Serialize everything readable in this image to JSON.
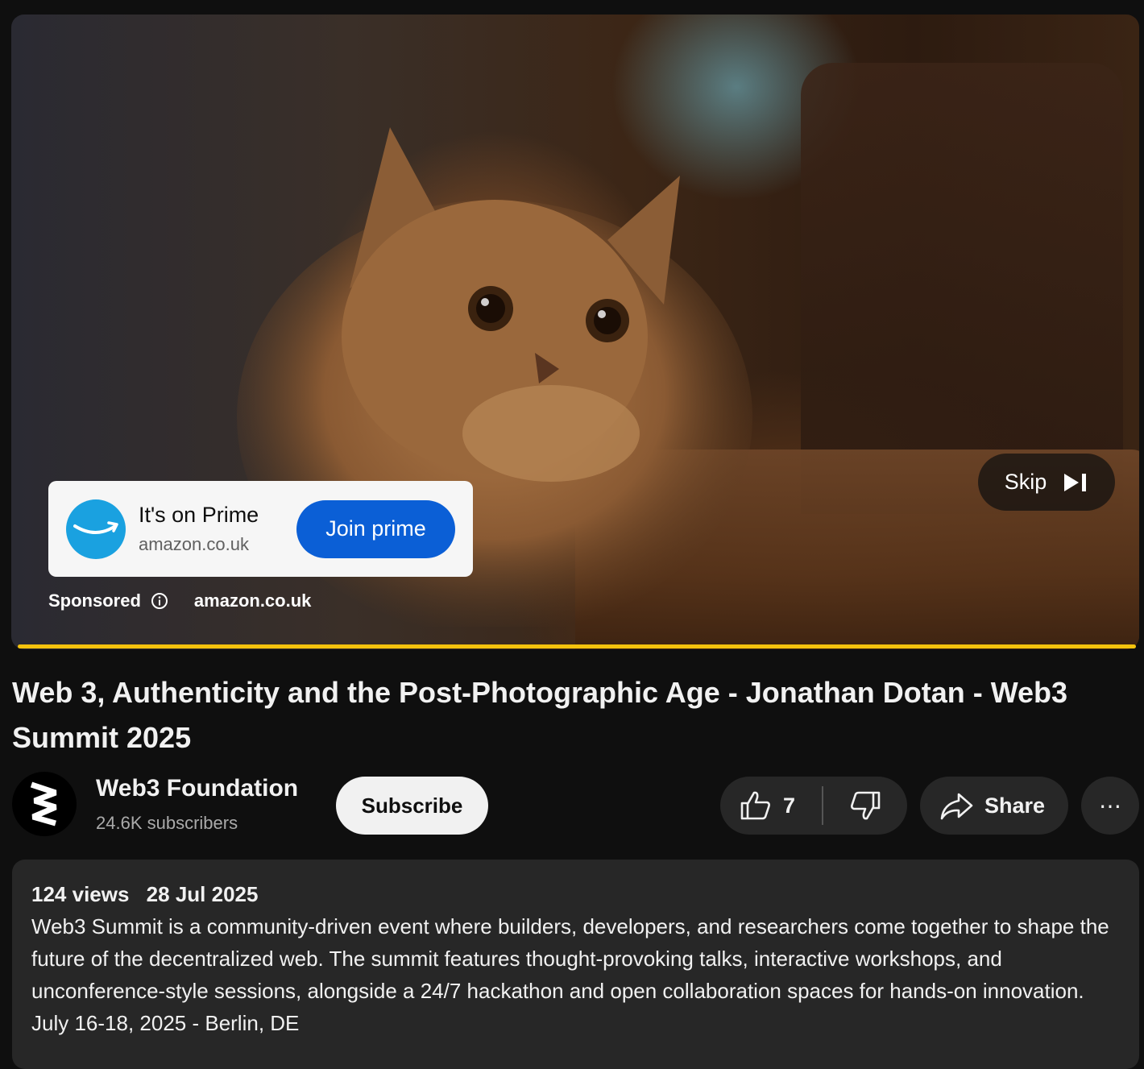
{
  "ad": {
    "headline": "It's on Prime",
    "domain": "amazon.co.uk",
    "cta_label": "Join prime",
    "sponsored_label": "Sponsored",
    "sponsor_domain": "amazon.co.uk",
    "skip_label": "Skip",
    "brand_color": "#1aa1e0",
    "cta_color": "#0b5fd6",
    "progress_color": "#f4c20d"
  },
  "video": {
    "title": "Web 3, Authenticity and the Post-Photographic Age - Jonathan Dotan - Web3 Summit 2025"
  },
  "channel": {
    "name": "Web3 Foundation",
    "subscribers": "24.6K subscribers",
    "subscribe_label": "Subscribe"
  },
  "actions": {
    "like_count": "7",
    "share_label": "Share",
    "more_label": "⋯"
  },
  "description": {
    "views": "124 views",
    "date": "28 Jul 2025",
    "text": "Web3 Summit is a community-driven event where builders, developers, and researchers come together to shape the future of the decentralized web. The summit features thought-provoking talks, interactive workshops, and unconference-style sessions, alongside a 24/7 hackathon and open collaboration spaces for hands-on innovation. July 16-18, 2025 - Berlin, DE"
  }
}
